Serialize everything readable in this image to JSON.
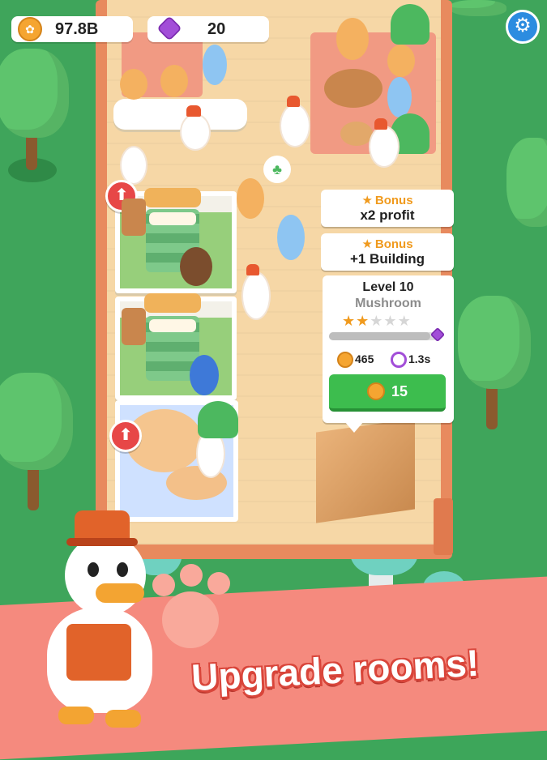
{
  "hud": {
    "coins": "97.8B",
    "gems": "20"
  },
  "bonuses": [
    {
      "title": "Bonus",
      "value": "x2 profit"
    },
    {
      "title": "Bonus",
      "value": "+1 Building"
    }
  ],
  "building": {
    "level": "Level 10",
    "name": "Mushroom",
    "stars_filled": 2,
    "stars_total": 5,
    "progress_fraction": 0.93,
    "income": "465",
    "speed": "1.3s",
    "upgrade_cost": "15"
  },
  "headline": "Upgrade rooms!",
  "icons": {
    "coin": "paw-coin-icon",
    "gem": "purple-gem-icon",
    "settings": "gear-icon",
    "upgrade": "up-arrow-icon",
    "timer": "timer-icon"
  },
  "colors": {
    "accent_green": "#3dbd4e",
    "bonus_orange": "#f09a1d",
    "banner_pink": "#f58a7e",
    "settings_blue": "#2c8ce0"
  }
}
